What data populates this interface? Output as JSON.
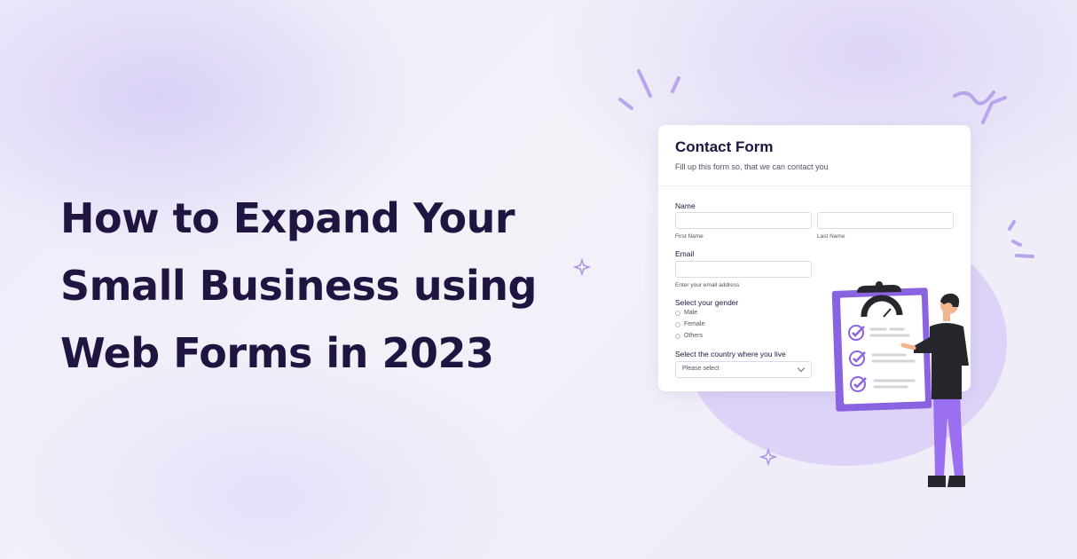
{
  "headline": {
    "line1": "How to Expand Your",
    "line2": "Small Business using",
    "line3": "Web Forms in 2023"
  },
  "form": {
    "title": "Contact Form",
    "subtitle": "Fill up this form so, that we can contact you",
    "name_label": "Name",
    "first_name_hint": "First Name",
    "last_name_hint": "Last Name",
    "email_label": "Email",
    "email_hint": "Enter your email address",
    "gender_label": "Select your gender",
    "gender_options": [
      "Male",
      "Female",
      "Others"
    ],
    "country_label": "Select the country where you live",
    "country_placeholder": "Please select"
  },
  "colors": {
    "heading": "#1f1540",
    "accent": "#8a63e0",
    "background": "#efeafb"
  }
}
